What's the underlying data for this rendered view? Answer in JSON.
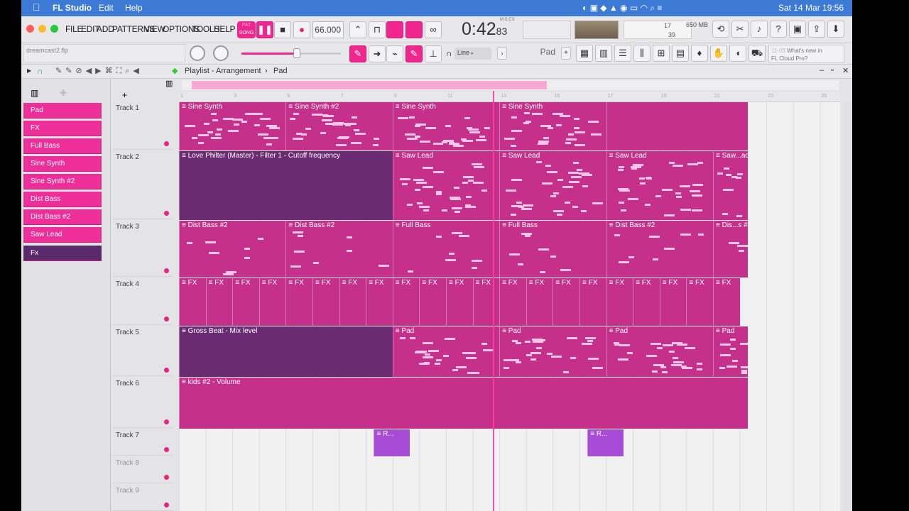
{
  "menubar": {
    "app": "FL Studio",
    "items": [
      "Edit",
      "Help"
    ],
    "datetime": "Sat 14 Mar  19:56"
  },
  "project_file": "dreamcast2.flp",
  "menu": [
    "FILE",
    "EDIT",
    "ADD",
    "PATTERNS",
    "VIEW",
    "OPTIONS",
    "TOOLS",
    "HELP"
  ],
  "transport": {
    "pat": "PAT",
    "song": "SONG",
    "tempo": "66.000",
    "time": "0:42",
    "time_sub": "83",
    "time_unit": "M:S:CS"
  },
  "stats": {
    "cpu": "17",
    "mem": "650 MB",
    "poly": "39"
  },
  "snap": {
    "label": "Line",
    "pattern": "Pad"
  },
  "news": {
    "date": "11-03",
    "text": "What's new in",
    "text2": "FL Cloud Pro?"
  },
  "playlist": {
    "title": "Playlist - Arrangement",
    "sep": "›",
    "pattern": "Pad"
  },
  "patterns": [
    "Pad",
    "FX",
    "Full Bass",
    "Sine Synth",
    "Sine Synth #2",
    "Dist Bass",
    "Dist Bass #2",
    "Saw Lead",
    "Fx"
  ],
  "ruler": [
    "1",
    "",
    "3",
    "",
    "5",
    "",
    "7",
    "",
    "9",
    "",
    "11",
    "",
    "13",
    "",
    "15",
    "",
    "17",
    "",
    "19",
    "",
    "21",
    "",
    "23",
    "",
    "25"
  ],
  "tracks": [
    "Track 1",
    "Track 2",
    "Track 3",
    "Track 4",
    "Track 5",
    "Track 6",
    "Track 7",
    "Track 8",
    "Track 9"
  ],
  "clips": {
    "t1": [
      "Sine Synth",
      "Sine Synth #2",
      "Sine Synth",
      "Sine Synth"
    ],
    "t2": [
      "Love Philter (Master) - Filter 1 - Cutoff frequency",
      "Saw Lead",
      "Saw Lead",
      "Saw Lead",
      "Saw...ad"
    ],
    "t3": [
      "Dist Bass #2",
      "Dist Bass #2",
      "Full Bass",
      "Full Bass",
      "Dist Bass #2",
      "Dis...s #2"
    ],
    "t4": "FX",
    "t5": [
      "Gross Beat - Mix level",
      "Pad",
      "Pad",
      "Pad",
      "Pad"
    ],
    "t6": "kids #2 - Volume",
    "t7": "R..."
  }
}
